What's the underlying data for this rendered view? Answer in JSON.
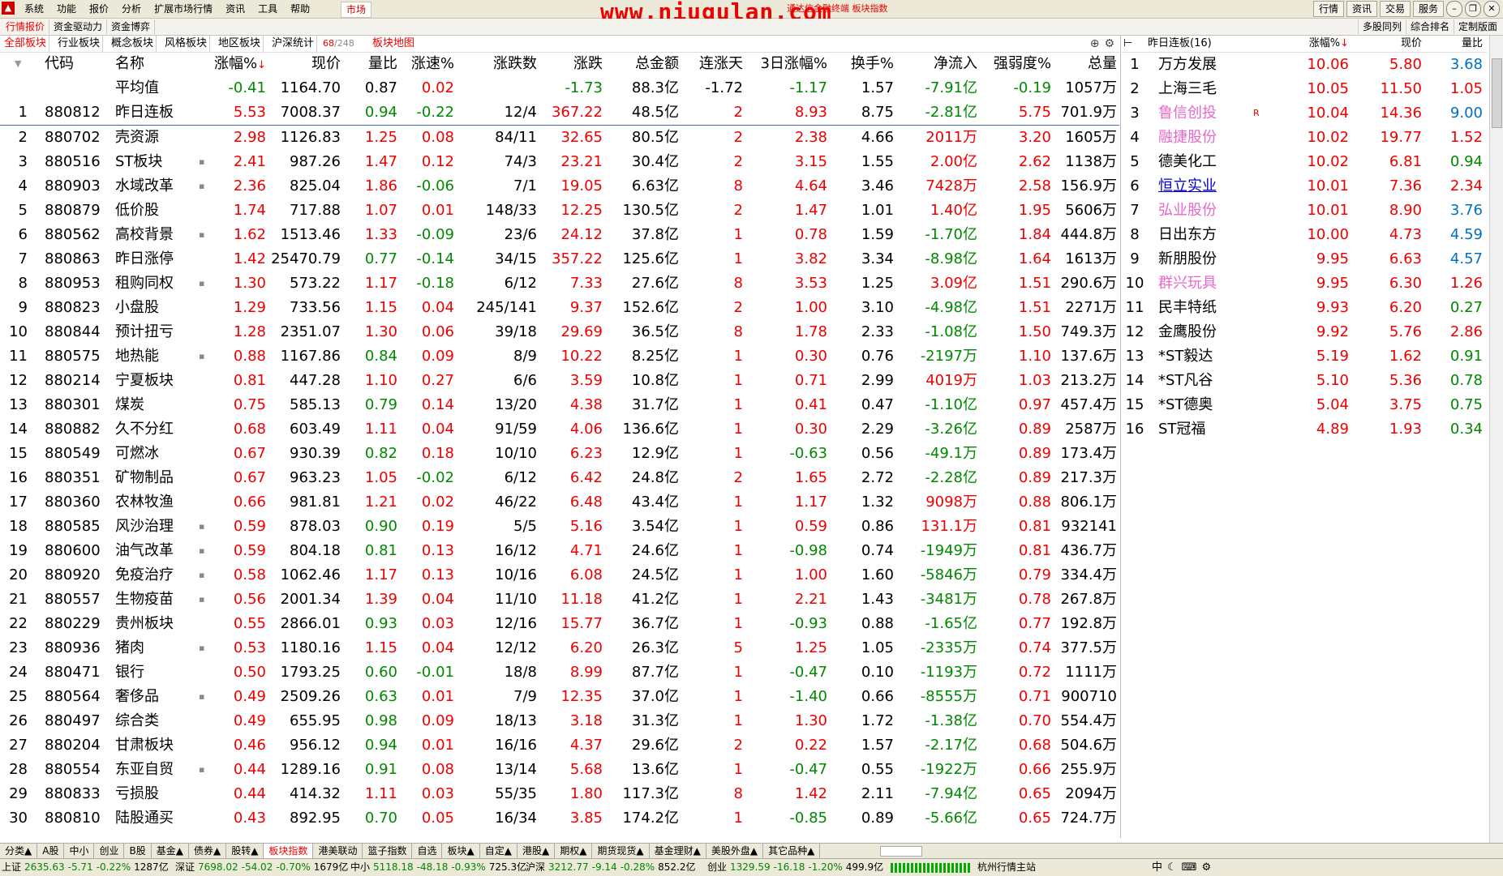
{
  "menubar": {
    "items": [
      "系统",
      "功能",
      "报价",
      "分析",
      "扩展市场行情",
      "资讯",
      "工具",
      "帮助"
    ],
    "market": "市场",
    "watermark": "www.niugulan.com",
    "watermark_sub": "通达信金融终端 板块指数",
    "right": [
      "行情",
      "资讯",
      "交易",
      "服务"
    ]
  },
  "subbar": {
    "tabs": [
      "行情报价",
      "资金驱动力",
      "资金博弈"
    ],
    "right_tabs": [
      "多股同列",
      "综合排名",
      "定制版面"
    ]
  },
  "blockbar": {
    "tabs": [
      "全部板块",
      "行业板块",
      "概念板块",
      "风格板块",
      "地区板块",
      "沪深统计"
    ],
    "count_current": "68",
    "count_total": "/248",
    "map": "板块地图"
  },
  "headers": {
    "code": "代码",
    "name": "名称",
    "pct": "涨幅%",
    "price": "现价",
    "lb": "量比",
    "zs": "涨速%",
    "zds": "涨跌数",
    "zd": "涨跌",
    "amt": "总金额",
    "lzt": "连涨天",
    "r3": "3日涨幅%",
    "hs": "换手%",
    "jlr": "净流入",
    "qrd": "强弱度%",
    "zl": "总量"
  },
  "avg": {
    "name": "平均值",
    "pct": "-0.41",
    "price": "1164.70",
    "lb": "0.87",
    "zs": "0.02",
    "zds": "",
    "zd": "-1.73",
    "amt": "88.3亿",
    "lzt": "-1.72",
    "r3": "-1.17",
    "hs": "1.57",
    "jlr": "-7.91亿",
    "qrd": "-0.19",
    "zl": "1057万"
  },
  "rows": [
    {
      "num": "1",
      "code": "880812",
      "name": "昨日连板",
      "mark": "",
      "pct": "5.53",
      "price": "7008.37",
      "lb": "0.94",
      "zs": "-0.22",
      "zds": "12/4",
      "zd": "367.22",
      "amt": "48.5亿",
      "lzt": "2",
      "r3": "8.93",
      "hs": "8.75",
      "jlr": "-2.81亿",
      "qrd": "5.75",
      "zl": "701.9万"
    },
    {
      "num": "2",
      "code": "880702",
      "name": "壳资源",
      "mark": "",
      "pct": "2.98",
      "price": "1126.83",
      "lb": "1.25",
      "zs": "0.08",
      "zds": "84/11",
      "zd": "32.65",
      "amt": "80.5亿",
      "lzt": "2",
      "r3": "2.38",
      "hs": "4.66",
      "jlr": "2011万",
      "qrd": "3.20",
      "zl": "1605万"
    },
    {
      "num": "3",
      "code": "880516",
      "name": "ST板块",
      "mark": "▪",
      "pct": "2.41",
      "price": "987.26",
      "lb": "1.47",
      "zs": "0.12",
      "zds": "74/3",
      "zd": "23.21",
      "amt": "30.4亿",
      "lzt": "2",
      "r3": "3.15",
      "hs": "1.55",
      "jlr": "2.00亿",
      "qrd": "2.62",
      "zl": "1138万"
    },
    {
      "num": "4",
      "code": "880903",
      "name": "水域改革",
      "mark": "▪",
      "pct": "2.36",
      "price": "825.04",
      "lb": "1.86",
      "zs": "-0.06",
      "zds": "7/1",
      "zd": "19.05",
      "amt": "6.63亿",
      "lzt": "8",
      "r3": "4.64",
      "hs": "3.46",
      "jlr": "7428万",
      "qrd": "2.58",
      "zl": "156.9万"
    },
    {
      "num": "5",
      "code": "880879",
      "name": "低价股",
      "mark": "",
      "pct": "1.74",
      "price": "717.88",
      "lb": "1.07",
      "zs": "0.01",
      "zds": "148/33",
      "zd": "12.25",
      "amt": "130.5亿",
      "lzt": "2",
      "r3": "1.47",
      "hs": "1.01",
      "jlr": "1.40亿",
      "qrd": "1.95",
      "zl": "5606万"
    },
    {
      "num": "6",
      "code": "880562",
      "name": "高校背景",
      "mark": "▪",
      "pct": "1.62",
      "price": "1513.46",
      "lb": "1.33",
      "zs": "-0.09",
      "zds": "23/6",
      "zd": "24.12",
      "amt": "37.8亿",
      "lzt": "1",
      "r3": "0.78",
      "hs": "1.59",
      "jlr": "-1.70亿",
      "qrd": "1.84",
      "zl": "444.8万"
    },
    {
      "num": "7",
      "code": "880863",
      "name": "昨日涨停",
      "mark": "",
      "pct": "1.42",
      "price": "25470.79",
      "lb": "0.77",
      "zs": "-0.14",
      "zds": "34/15",
      "zd": "357.22",
      "amt": "125.6亿",
      "lzt": "1",
      "r3": "3.82",
      "hs": "3.34",
      "jlr": "-8.98亿",
      "qrd": "1.64",
      "zl": "1613万"
    },
    {
      "num": "8",
      "code": "880953",
      "name": "租购同权",
      "mark": "▪",
      "pct": "1.30",
      "price": "573.22",
      "lb": "1.17",
      "zs": "-0.18",
      "zds": "6/12",
      "zd": "7.33",
      "amt": "27.6亿",
      "lzt": "8",
      "r3": "3.53",
      "hs": "1.25",
      "jlr": "3.09亿",
      "qrd": "1.51",
      "zl": "290.6万"
    },
    {
      "num": "9",
      "code": "880823",
      "name": "小盘股",
      "mark": "",
      "pct": "1.29",
      "price": "733.56",
      "lb": "1.15",
      "zs": "0.04",
      "zds": "245/141",
      "zd": "9.37",
      "amt": "152.6亿",
      "lzt": "2",
      "r3": "1.00",
      "hs": "3.10",
      "jlr": "-4.98亿",
      "qrd": "1.51",
      "zl": "2271万"
    },
    {
      "num": "10",
      "code": "880844",
      "name": "预计扭亏",
      "mark": "",
      "pct": "1.28",
      "price": "2351.07",
      "lb": "1.30",
      "zs": "0.06",
      "zds": "39/18",
      "zd": "29.69",
      "amt": "36.5亿",
      "lzt": "8",
      "r3": "1.78",
      "hs": "2.33",
      "jlr": "-1.08亿",
      "qrd": "1.50",
      "zl": "749.3万"
    },
    {
      "num": "11",
      "code": "880575",
      "name": "地热能",
      "mark": "▪",
      "pct": "0.88",
      "price": "1167.86",
      "lb": "0.84",
      "zs": "0.09",
      "zds": "8/9",
      "zd": "10.22",
      "amt": "8.25亿",
      "lzt": "1",
      "r3": "0.30",
      "hs": "0.76",
      "jlr": "-2197万",
      "qrd": "1.10",
      "zl": "137.6万"
    },
    {
      "num": "12",
      "code": "880214",
      "name": "宁夏板块",
      "mark": "",
      "pct": "0.81",
      "price": "447.28",
      "lb": "1.10",
      "zs": "0.27",
      "zds": "6/6",
      "zd": "3.59",
      "amt": "10.8亿",
      "lzt": "1",
      "r3": "0.71",
      "hs": "2.99",
      "jlr": "4019万",
      "qrd": "1.03",
      "zl": "213.2万"
    },
    {
      "num": "13",
      "code": "880301",
      "name": "煤炭",
      "mark": "",
      "pct": "0.75",
      "price": "585.13",
      "lb": "0.79",
      "zs": "0.14",
      "zds": "13/20",
      "zd": "4.38",
      "amt": "31.7亿",
      "lzt": "1",
      "r3": "0.41",
      "hs": "0.47",
      "jlr": "-1.10亿",
      "qrd": "0.97",
      "zl": "457.4万"
    },
    {
      "num": "14",
      "code": "880882",
      "name": "久不分红",
      "mark": "",
      "pct": "0.68",
      "price": "603.49",
      "lb": "1.11",
      "zs": "0.04",
      "zds": "91/59",
      "zd": "4.06",
      "amt": "136.6亿",
      "lzt": "1",
      "r3": "0.30",
      "hs": "2.29",
      "jlr": "-3.26亿",
      "qrd": "0.89",
      "zl": "2587万"
    },
    {
      "num": "15",
      "code": "880549",
      "name": "可燃冰",
      "mark": "",
      "pct": "0.67",
      "price": "930.39",
      "lb": "0.82",
      "zs": "0.18",
      "zds": "10/10",
      "zd": "6.23",
      "amt": "12.9亿",
      "lzt": "1",
      "r3": "-0.63",
      "hs": "0.56",
      "jlr": "-49.1万",
      "qrd": "0.89",
      "zl": "173.4万"
    },
    {
      "num": "16",
      "code": "880351",
      "name": "矿物制品",
      "mark": "",
      "pct": "0.67",
      "price": "963.23",
      "lb": "1.05",
      "zs": "-0.02",
      "zds": "6/12",
      "zd": "6.42",
      "amt": "24.8亿",
      "lzt": "2",
      "r3": "1.65",
      "hs": "2.72",
      "jlr": "-2.28亿",
      "qrd": "0.89",
      "zl": "217.3万"
    },
    {
      "num": "17",
      "code": "880360",
      "name": "农林牧渔",
      "mark": "",
      "pct": "0.66",
      "price": "981.81",
      "lb": "1.21",
      "zs": "0.02",
      "zds": "46/22",
      "zd": "6.48",
      "amt": "43.4亿",
      "lzt": "1",
      "r3": "1.17",
      "hs": "1.32",
      "jlr": "9098万",
      "qrd": "0.88",
      "zl": "806.1万"
    },
    {
      "num": "18",
      "code": "880585",
      "name": "风沙治理",
      "mark": "▪",
      "pct": "0.59",
      "price": "878.03",
      "lb": "0.90",
      "zs": "0.19",
      "zds": "5/5",
      "zd": "5.16",
      "amt": "3.54亿",
      "lzt": "1",
      "r3": "0.59",
      "hs": "0.86",
      "jlr": "131.1万",
      "qrd": "0.81",
      "zl": "932141"
    },
    {
      "num": "19",
      "code": "880600",
      "name": "油气改革",
      "mark": "▪",
      "pct": "0.59",
      "price": "804.18",
      "lb": "0.81",
      "zs": "0.13",
      "zds": "16/12",
      "zd": "4.71",
      "amt": "24.6亿",
      "lzt": "1",
      "r3": "-0.98",
      "hs": "0.74",
      "jlr": "-1949万",
      "qrd": "0.81",
      "zl": "436.7万"
    },
    {
      "num": "20",
      "code": "880920",
      "name": "免疫治疗",
      "mark": "▪",
      "pct": "0.58",
      "price": "1062.46",
      "lb": "1.17",
      "zs": "0.13",
      "zds": "10/16",
      "zd": "6.08",
      "amt": "24.5亿",
      "lzt": "1",
      "r3": "1.00",
      "hs": "1.60",
      "jlr": "-5846万",
      "qrd": "0.79",
      "zl": "334.4万"
    },
    {
      "num": "21",
      "code": "880557",
      "name": "生物疫苗",
      "mark": "▪",
      "pct": "0.56",
      "price": "2001.34",
      "lb": "1.39",
      "zs": "0.04",
      "zds": "11/10",
      "zd": "11.18",
      "amt": "41.2亿",
      "lzt": "1",
      "r3": "2.21",
      "hs": "1.43",
      "jlr": "-3481万",
      "qrd": "0.78",
      "zl": "267.8万"
    },
    {
      "num": "22",
      "code": "880229",
      "name": "贵州板块",
      "mark": "",
      "pct": "0.55",
      "price": "2866.01",
      "lb": "0.93",
      "zs": "0.03",
      "zds": "12/16",
      "zd": "15.77",
      "amt": "36.7亿",
      "lzt": "1",
      "r3": "-0.93",
      "hs": "0.88",
      "jlr": "-1.65亿",
      "qrd": "0.77",
      "zl": "192.8万"
    },
    {
      "num": "23",
      "code": "880936",
      "name": "猪肉",
      "mark": "▪",
      "pct": "0.53",
      "price": "1180.16",
      "lb": "1.15",
      "zs": "0.04",
      "zds": "12/12",
      "zd": "6.20",
      "amt": "26.3亿",
      "lzt": "5",
      "r3": "1.25",
      "hs": "1.05",
      "jlr": "-2335万",
      "qrd": "0.74",
      "zl": "377.5万"
    },
    {
      "num": "24",
      "code": "880471",
      "name": "银行",
      "mark": "",
      "pct": "0.50",
      "price": "1793.25",
      "lb": "0.60",
      "zs": "-0.01",
      "zds": "18/8",
      "zd": "8.99",
      "amt": "87.7亿",
      "lzt": "1",
      "r3": "-0.47",
      "hs": "0.10",
      "jlr": "-1193万",
      "qrd": "0.72",
      "zl": "1111万"
    },
    {
      "num": "25",
      "code": "880564",
      "name": "奢侈品",
      "mark": "▪",
      "pct": "0.49",
      "price": "2509.26",
      "lb": "0.63",
      "zs": "0.01",
      "zds": "7/9",
      "zd": "12.35",
      "amt": "37.0亿",
      "lzt": "1",
      "r3": "-1.40",
      "hs": "0.66",
      "jlr": "-8555万",
      "qrd": "0.71",
      "zl": "900710"
    },
    {
      "num": "26",
      "code": "880497",
      "name": "综合类",
      "mark": "",
      "pct": "0.49",
      "price": "655.95",
      "lb": "0.98",
      "zs": "0.09",
      "zds": "18/13",
      "zd": "3.18",
      "amt": "31.3亿",
      "lzt": "1",
      "r3": "1.30",
      "hs": "1.72",
      "jlr": "-1.38亿",
      "qrd": "0.70",
      "zl": "554.4万"
    },
    {
      "num": "27",
      "code": "880204",
      "name": "甘肃板块",
      "mark": "",
      "pct": "0.46",
      "price": "956.12",
      "lb": "0.94",
      "zs": "0.01",
      "zds": "16/16",
      "zd": "4.37",
      "amt": "29.6亿",
      "lzt": "2",
      "r3": "0.22",
      "hs": "1.57",
      "jlr": "-2.17亿",
      "qrd": "0.68",
      "zl": "504.6万"
    },
    {
      "num": "28",
      "code": "880554",
      "name": "东亚自贸",
      "mark": "▪",
      "pct": "0.44",
      "price": "1289.16",
      "lb": "0.91",
      "zs": "0.08",
      "zds": "13/14",
      "zd": "5.68",
      "amt": "13.6亿",
      "lzt": "1",
      "r3": "-0.47",
      "hs": "0.55",
      "jlr": "-1922万",
      "qrd": "0.66",
      "zl": "255.9万"
    },
    {
      "num": "29",
      "code": "880833",
      "name": "亏损股",
      "mark": "",
      "pct": "0.44",
      "price": "414.32",
      "lb": "1.11",
      "zs": "0.03",
      "zds": "55/35",
      "zd": "1.80",
      "amt": "117.3亿",
      "lzt": "8",
      "r3": "1.42",
      "hs": "2.11",
      "jlr": "-7.94亿",
      "qrd": "0.65",
      "zl": "2094万"
    },
    {
      "num": "30",
      "code": "880810",
      "name": "陆股通买",
      "mark": "",
      "pct": "0.43",
      "price": "892.95",
      "lb": "0.70",
      "zs": "0.05",
      "zds": "16/34",
      "zd": "3.85",
      "amt": "174.2亿",
      "lzt": "1",
      "r3": "-0.85",
      "hs": "0.89",
      "jlr": "-5.66亿",
      "qrd": "0.65",
      "zl": "724.7万"
    }
  ],
  "right_panel": {
    "title": "昨日连板(16)",
    "headers": {
      "pct": "涨幅%",
      "price": "现价",
      "lb": "量比"
    },
    "rows": [
      {
        "num": "1",
        "name": "万方发展",
        "style": "",
        "flag": "",
        "pct": "10.06",
        "price": "5.80",
        "lb": "3.68",
        "lb_color": "blue"
      },
      {
        "num": "2",
        "name": "上海三毛",
        "style": "",
        "flag": "",
        "pct": "10.05",
        "price": "11.50",
        "lb": "1.05",
        "lb_color": "red"
      },
      {
        "num": "3",
        "name": "鲁信创投",
        "style": "pink",
        "flag": "R",
        "pct": "10.04",
        "price": "14.36",
        "lb": "9.00",
        "lb_color": "blue"
      },
      {
        "num": "4",
        "name": "融捷股份",
        "style": "pink",
        "flag": "",
        "pct": "10.02",
        "price": "19.77",
        "lb": "1.52",
        "lb_color": "red"
      },
      {
        "num": "5",
        "name": "德美化工",
        "style": "",
        "flag": "",
        "pct": "10.02",
        "price": "6.81",
        "lb": "0.94",
        "lb_color": "green"
      },
      {
        "num": "6",
        "name": "恒立实业",
        "style": "link",
        "flag": "",
        "pct": "10.01",
        "price": "7.36",
        "lb": "2.34",
        "lb_color": "red"
      },
      {
        "num": "7",
        "name": "弘业股份",
        "style": "pink",
        "flag": "",
        "pct": "10.01",
        "price": "8.90",
        "lb": "3.76",
        "lb_color": "blue"
      },
      {
        "num": "8",
        "name": "日出东方",
        "style": "",
        "flag": "",
        "pct": "10.00",
        "price": "4.73",
        "lb": "4.59",
        "lb_color": "blue"
      },
      {
        "num": "9",
        "name": "新朋股份",
        "style": "",
        "flag": "",
        "pct": "9.95",
        "price": "6.63",
        "lb": "4.57",
        "lb_color": "blue"
      },
      {
        "num": "10",
        "name": "群兴玩具",
        "style": "pink",
        "flag": "",
        "pct": "9.95",
        "price": "6.30",
        "lb": "1.26",
        "lb_color": "red"
      },
      {
        "num": "11",
        "name": "民丰特纸",
        "style": "",
        "flag": "",
        "pct": "9.93",
        "price": "6.20",
        "lb": "0.27",
        "lb_color": "green"
      },
      {
        "num": "12",
        "name": "金鹰股份",
        "style": "",
        "flag": "",
        "pct": "9.92",
        "price": "5.76",
        "lb": "2.86",
        "lb_color": "red"
      },
      {
        "num": "13",
        "name": "*ST毅达",
        "style": "",
        "flag": "",
        "pct": "5.19",
        "price": "1.62",
        "lb": "0.91",
        "lb_color": "green"
      },
      {
        "num": "14",
        "name": "*ST凡谷",
        "style": "",
        "flag": "",
        "pct": "5.10",
        "price": "5.36",
        "lb": "0.78",
        "lb_color": "green"
      },
      {
        "num": "15",
        "name": "*ST德奥",
        "style": "",
        "flag": "",
        "pct": "5.04",
        "price": "3.75",
        "lb": "0.75",
        "lb_color": "green"
      },
      {
        "num": "16",
        "name": "ST冠福",
        "style": "",
        "flag": "",
        "pct": "4.89",
        "price": "1.93",
        "lb": "0.34",
        "lb_color": "green"
      }
    ]
  },
  "bottom_tabs": [
    "分类▲",
    "A股",
    "中小",
    "创业",
    "B股",
    "基金▲",
    "债券▲",
    "股转▲",
    "板块指数",
    "港美联动",
    "篮子指数",
    "自选",
    "板块▲",
    "自定▲",
    "港股▲",
    "期权▲",
    "期货现货▲",
    "基金理财▲",
    "美股外盘▲",
    "其它品种▲"
  ],
  "bottom_active": "板块指数",
  "status": [
    {
      "label": "上证",
      "val": "2635.63",
      "chg": "-5.71",
      "pct": "-0.22%",
      "amt": "1287亿"
    },
    {
      "label": "深证",
      "val": "7698.02",
      "chg": "-54.02",
      "pct": "-0.70%",
      "amt": "1679亿"
    },
    {
      "label": "中小",
      "val": "5118.18",
      "chg": "-48.18",
      "pct": "-0.93%",
      "amt": "725.3亿"
    },
    {
      "label": "沪深",
      "val": "3212.77",
      "chg": "-9.14",
      "pct": "-0.28%",
      "amt": "852.2亿"
    },
    {
      "label": "创业",
      "val": "1329.59",
      "chg": "-16.18",
      "pct": "-1.20%",
      "amt": "499.9亿"
    }
  ],
  "server": "杭州行情主站",
  "colors": {
    "up": "#ee0000",
    "down": "#008800",
    "pink": "#e868c8",
    "link": "#0000cc"
  }
}
